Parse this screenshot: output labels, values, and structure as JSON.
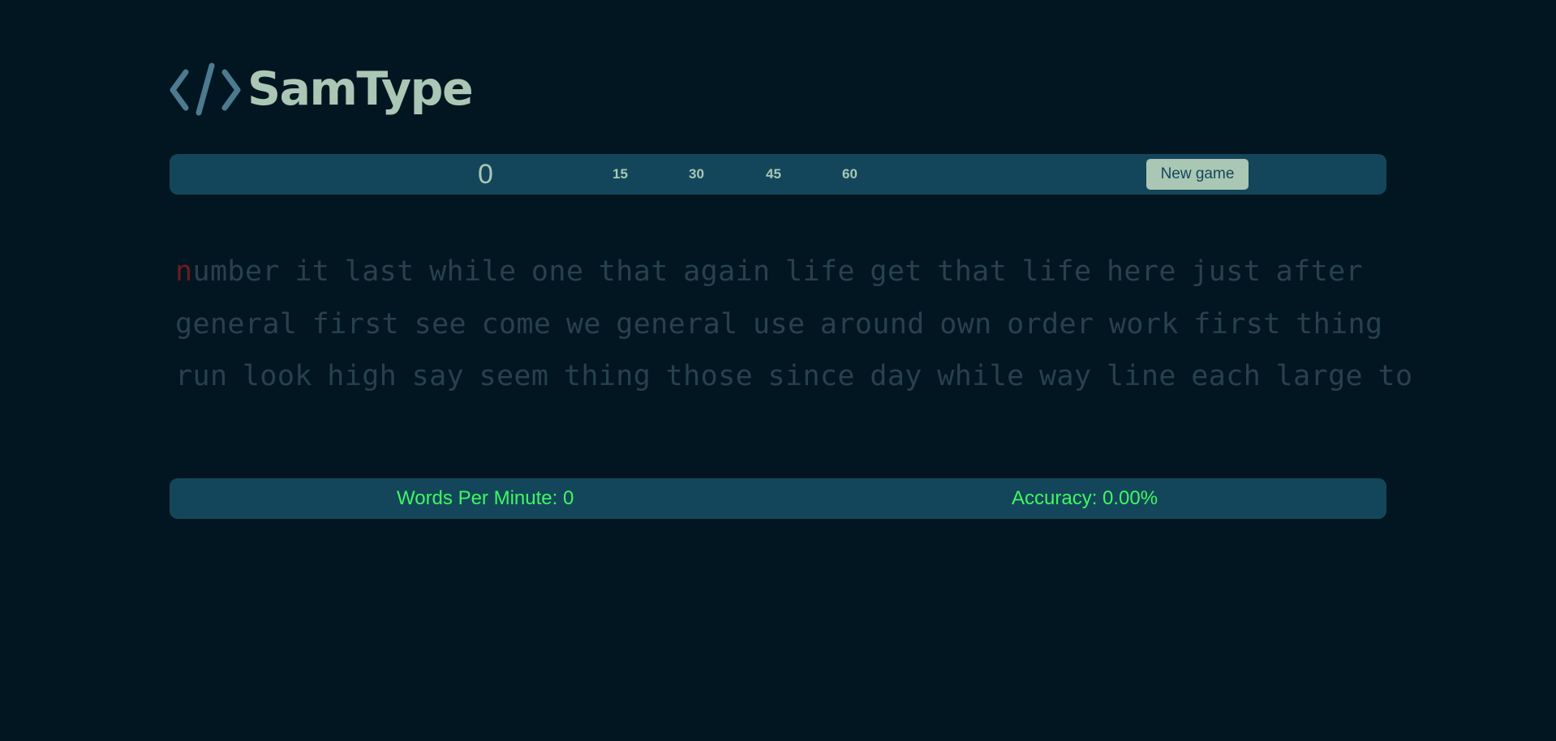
{
  "app": {
    "title": "SamType",
    "logo_icon": "code-brackets-icon"
  },
  "toolbar": {
    "timer": "0",
    "durations": [
      "15",
      "30",
      "45",
      "60"
    ],
    "new_game_label": "New game"
  },
  "words": {
    "current_char": "n",
    "lines": [
      "umber it last while one that again life get that life here just after",
      "general first see come we general use around own order work first thing",
      "run look high say seem thing those since day while way line each large to"
    ]
  },
  "stats": {
    "wpm": "Words Per Minute: 0",
    "accuracy": "Accuracy: 0.00%"
  },
  "colors": {
    "background": "#011621",
    "panel": "#14465b",
    "accent": "#a9c7b4",
    "stat_text": "#3df95f",
    "untyped_text": "#27414d",
    "cursor_char": "#6e1b1f"
  }
}
